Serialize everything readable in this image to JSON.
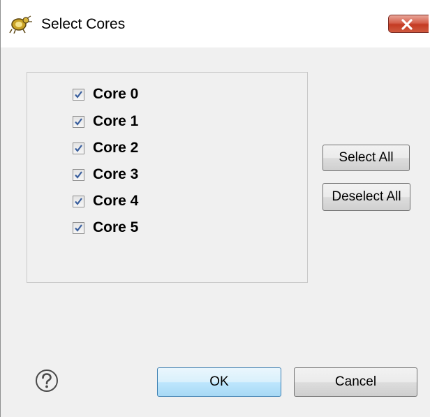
{
  "window": {
    "title": "Select Cores",
    "icon": "app-bug-icon",
    "close_icon": "close-icon"
  },
  "cores": [
    {
      "label": "Core 0",
      "checked": true
    },
    {
      "label": "Core 1",
      "checked": true
    },
    {
      "label": "Core 2",
      "checked": true
    },
    {
      "label": "Core 3",
      "checked": true
    },
    {
      "label": "Core 4",
      "checked": true
    },
    {
      "label": "Core 5",
      "checked": true
    }
  ],
  "buttons": {
    "select_all": "Select All",
    "deselect_all": "Deselect All",
    "ok": "OK",
    "cancel": "Cancel"
  },
  "help_icon": "help-question-icon",
  "colors": {
    "dialog_bg": "#f0f0f0",
    "close_red": "#c43b23",
    "default_button_border": "#3c7fb1"
  }
}
